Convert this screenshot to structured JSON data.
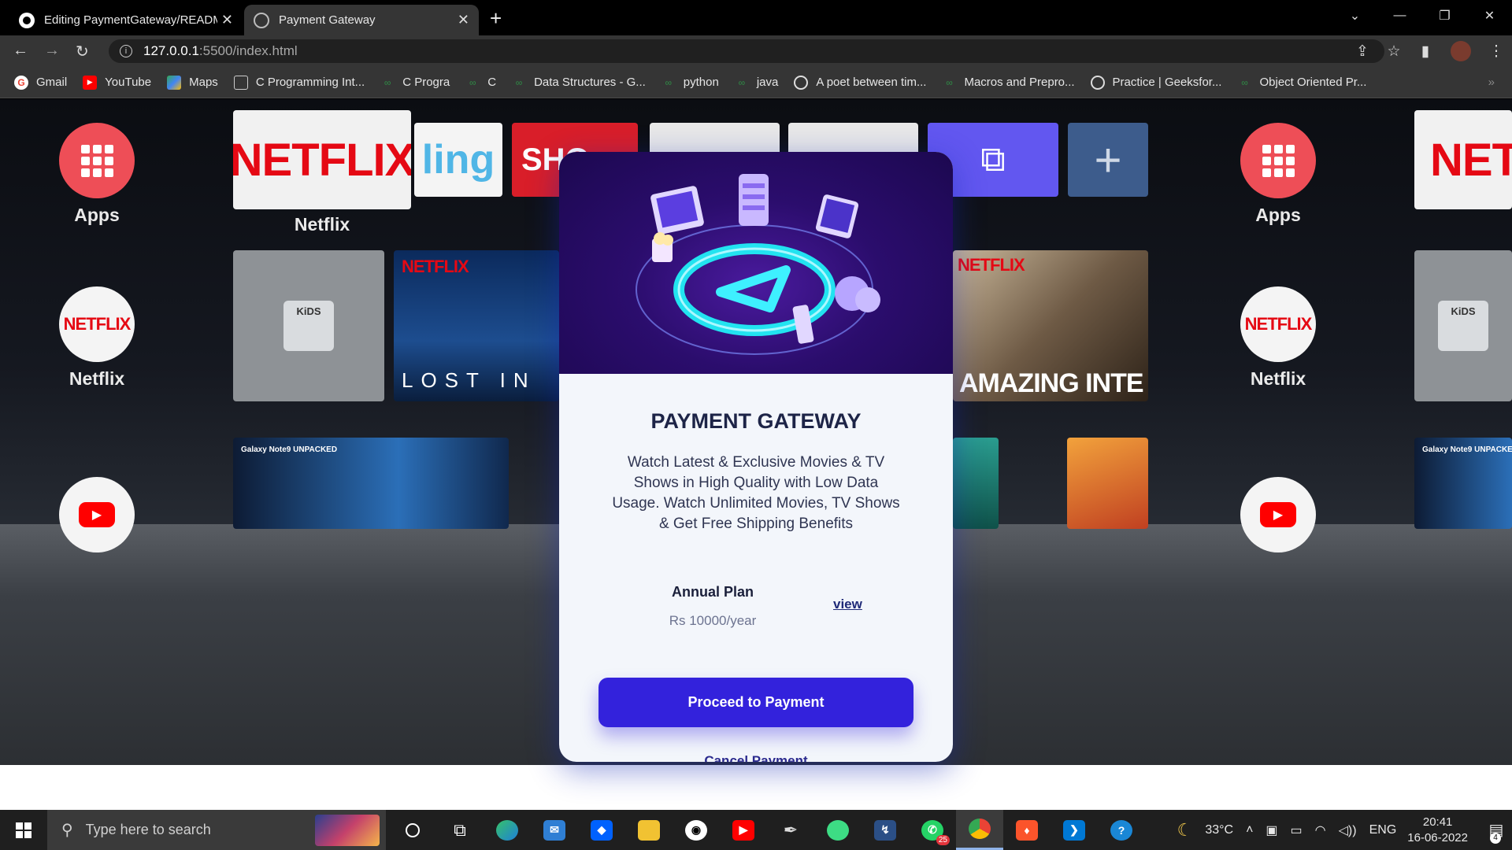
{
  "tabs": [
    {
      "title": "Editing PaymentGateway/README",
      "active": false
    },
    {
      "title": "Payment Gateway",
      "active": true
    }
  ],
  "toolbar": {
    "url_host": "127.0.0.1",
    "url_path": ":5500/index.html"
  },
  "bookmarks": [
    {
      "label": "Gmail",
      "icon": "google-icon",
      "color": "#ea4335"
    },
    {
      "label": "YouTube",
      "icon": "youtube-icon",
      "color": "#ff0000"
    },
    {
      "label": "Maps",
      "icon": "maps-icon",
      "color": "#34a853"
    },
    {
      "label": "C Programming Int...",
      "icon": "site-icon",
      "color": "#cccccc"
    },
    {
      "label": "C Progra",
      "icon": "gfg-icon",
      "color": "#2f8d46"
    },
    {
      "label": "C",
      "icon": "gfg-icon",
      "color": "#2f8d46"
    },
    {
      "label": "Data Structures - G...",
      "icon": "gfg-icon",
      "color": "#2f8d46"
    },
    {
      "label": "python",
      "icon": "gfg-icon",
      "color": "#2f8d46"
    },
    {
      "label": "java",
      "icon": "gfg-icon",
      "color": "#2f8d46"
    },
    {
      "label": "A poet between tim...",
      "icon": "globe-icon",
      "color": "#cccccc"
    },
    {
      "label": "Macros and Prepro...",
      "icon": "gfg-icon",
      "color": "#2f8d46"
    },
    {
      "label": "Practice | Geeksfor...",
      "icon": "globe-icon",
      "color": "#cccccc"
    },
    {
      "label": "Object Oriented Pr...",
      "icon": "gfg-icon",
      "color": "#2f8d46"
    }
  ],
  "background_tv": {
    "apps_label": "Apps",
    "netflix_label": "Netflix",
    "netflix_word": "NETFLIX",
    "kids_word": "KiDS",
    "lost_in": "LOST IN",
    "amazing": "AMAZING INTE",
    "galaxy": "Galaxy Note9 UNPACKED",
    "ling": "ling",
    "sho": "SHO"
  },
  "card": {
    "title": "PAYMENT GATEWAY",
    "description": "Watch Latest & Exclusive Movies & TV Shows in High Quality with Low Data Usage. Watch Unlimited Movies, TV Shows & Get Free Shipping Benefits",
    "plan_name": "Annual Plan",
    "plan_price": "Rs 10000/year",
    "view_label": "view",
    "pay_button": "Proceed to Payment",
    "cancel_label": "Cancel Payment",
    "accent": "#3322dc"
  },
  "taskbar": {
    "search_placeholder": "Type here to search",
    "whatsapp_badge": "25",
    "temperature": "33°C",
    "language": "ENG",
    "time": "20:41",
    "date": "16-06-2022",
    "notification_count": "4"
  }
}
